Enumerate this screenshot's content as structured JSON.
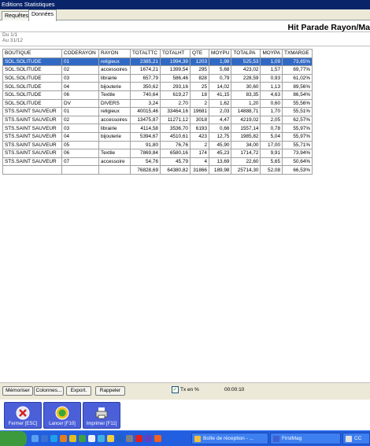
{
  "window": {
    "title": "Editions Statistiques"
  },
  "tabs": [
    {
      "label": "Requêtes"
    },
    {
      "label": "Données"
    }
  ],
  "report": {
    "title": "Hit Parade Rayon/Ma",
    "date_from": "Du 1/1",
    "date_to": "Au 31/12"
  },
  "table": {
    "headers": [
      "BOUTIQUE",
      "CODERAYON",
      "RAYON",
      "TOTALTTC",
      "TOTALHT",
      "QTE",
      "MOYPU",
      "TOTALPA",
      "MOYPA",
      "TXMARGE"
    ],
    "rows": [
      [
        "SOL.SOLITUDE",
        "01",
        "religieux",
        "2385,21",
        "1994,39",
        "1203",
        "1,98",
        "525,53",
        "1,09",
        "73,65%"
      ],
      [
        "SOL.SOLITUDE",
        "02",
        "accessoires",
        "1674,21",
        "1399,54",
        "295",
        "5,68",
        "423,02",
        "1,57",
        "69,77%"
      ],
      [
        "SOL.SOLITUDE",
        "03",
        "librairie",
        "657,79",
        "586,46",
        "828",
        "0,79",
        "228,59",
        "0,93",
        "61,02%"
      ],
      [
        "SOL.SOLITUDE",
        "04",
        "bijouterie",
        "350,62",
        "293,16",
        "25",
        "14,02",
        "30,60",
        "1,13",
        "89,56%"
      ],
      [
        "SOL.SOLITUDE",
        "06",
        "Textile",
        "740,64",
        "619,27",
        "18",
        "41,15",
        "83,35",
        "4,63",
        "86,54%"
      ],
      [
        "SOL.SOLITUDE",
        "DV",
        "DIVERS",
        "3,24",
        "2,70",
        "2",
        "1,62",
        "1,20",
        "0,60",
        "55,56%"
      ],
      [
        "STS.SAINT SAUVEUR",
        "01",
        "religieux",
        "40015,46",
        "33464,16",
        "19681",
        "2,03",
        "14888,71",
        "1,70",
        "55,51%"
      ],
      [
        "STS.SAINT SAUVEUR",
        "02",
        "accessoires",
        "13475,87",
        "11271,12",
        "3018",
        "4,47",
        "4219,02",
        "2,05",
        "62,57%"
      ],
      [
        "STS.SAINT SAUVEUR",
        "03",
        "librairie",
        "4114,58",
        "3536,70",
        "6193",
        "0,66",
        "1557,14",
        "0,78",
        "55,97%"
      ],
      [
        "STS.SAINT SAUVEUR",
        "04",
        "bijouterie",
        "5394,67",
        "4510,61",
        "423",
        "12,75",
        "1985,82",
        "5,04",
        "55,97%"
      ],
      [
        "STS.SAINT SAUVEUR",
        "05",
        "",
        "91,80",
        "76,76",
        "2",
        "45,90",
        "34,00",
        "17,00",
        "55,71%"
      ],
      [
        "STS.SAINT SAUVEUR",
        "06",
        "Textile",
        "7869,84",
        "6580,16",
        "174",
        "45,23",
        "1714,72",
        "9,91",
        "73,94%"
      ],
      [
        "STS.SAINT SAUVEUR",
        "07",
        "accessoire",
        "54,76",
        "45,79",
        "4",
        "13,69",
        "22,60",
        "5,65",
        "50,64%"
      ]
    ],
    "totals": [
      "",
      "",
      "",
      "76828,69",
      "64380,82",
      "31866",
      "189,98",
      "25714,30",
      "52,08",
      "66,53%"
    ]
  },
  "bottombar": {
    "memoriser": "Mémoriser",
    "colonnes": "Colonnes...",
    "export": "Export.",
    "rappeler": "Rappeler",
    "tx_label": "Tx en %",
    "tx_checked": true,
    "timer": "00:00:10"
  },
  "actions": [
    {
      "label": "Fermer [ESC]",
      "icon": "close-icon"
    },
    {
      "label": "Lancer [F10]",
      "icon": "launch-icon"
    },
    {
      "label": "Imprimer [F11]",
      "icon": "printer-icon"
    }
  ],
  "taskbar": {
    "tasks": [
      {
        "label": "Boîte de réception - ..."
      },
      {
        "label": "FirstMag"
      },
      {
        "label": "CC"
      }
    ]
  },
  "colors": {
    "title_bar": "#0a246a",
    "selection": "#316ac5",
    "action_button": "#4a5fd8",
    "taskbar": "#225ee0"
  }
}
